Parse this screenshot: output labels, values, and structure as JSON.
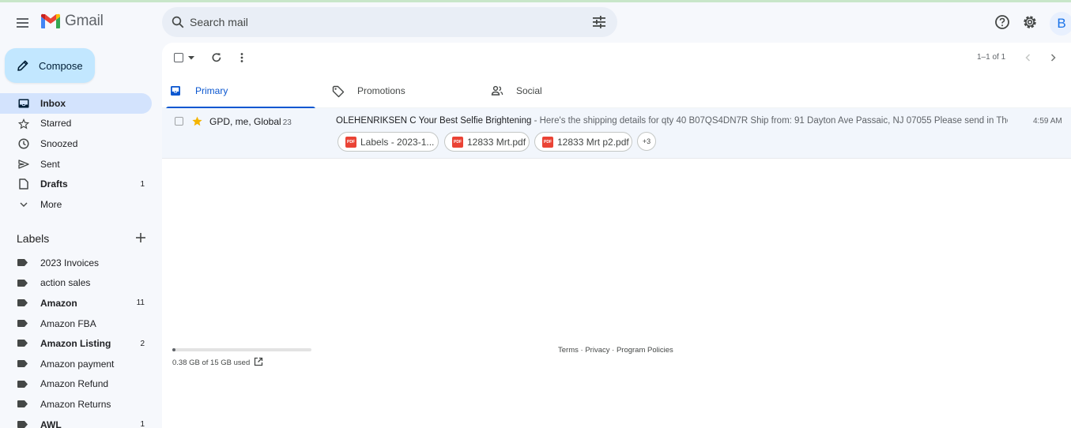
{
  "app": {
    "name": "Gmail",
    "avatar_initial": "B"
  },
  "search": {
    "placeholder": "Search mail"
  },
  "compose": {
    "label": "Compose"
  },
  "nav": [
    {
      "label": "Inbox",
      "icon": "inbox-icon",
      "count": "",
      "active": true,
      "bold": true
    },
    {
      "label": "Starred",
      "icon": "star-outline-icon",
      "count": ""
    },
    {
      "label": "Snoozed",
      "icon": "clock-icon",
      "count": ""
    },
    {
      "label": "Sent",
      "icon": "send-icon",
      "count": ""
    },
    {
      "label": "Drafts",
      "icon": "draft-icon",
      "count": "1",
      "bold": true
    },
    {
      "label": "More",
      "icon": "chevron-down-icon",
      "count": ""
    }
  ],
  "labels": {
    "heading": "Labels",
    "items": [
      {
        "label": "2023 Invoices",
        "count": ""
      },
      {
        "label": "action sales",
        "count": ""
      },
      {
        "label": "Amazon",
        "count": "11",
        "bold": true
      },
      {
        "label": "Amazon FBA",
        "count": ""
      },
      {
        "label": "Amazon Listing",
        "count": "2",
        "bold": true
      },
      {
        "label": "Amazon payment",
        "count": ""
      },
      {
        "label": "Amazon Refund",
        "count": ""
      },
      {
        "label": "Amazon Returns",
        "count": ""
      },
      {
        "label": "AWL",
        "count": "1",
        "bold": true
      }
    ]
  },
  "toolbar": {
    "pagination": "1–1 of 1"
  },
  "tabs": [
    {
      "label": "Primary",
      "icon": "inbox-tab-icon",
      "active": true
    },
    {
      "label": "Promotions",
      "icon": "tag-icon"
    },
    {
      "label": "Social",
      "icon": "people-icon"
    }
  ],
  "emails": [
    {
      "senders": "GPD, me, Global",
      "thread_count": "23",
      "subject": "OLEHENRIKSEN C Your Best Selfie Brightening",
      "snippet": " - Here's the shipping details for qty 40 B07QS4DN7R Ship from: 91 Dayton Ave Passaic, NJ 07055 Please send in The...",
      "time": "4:59 AM",
      "starred": true,
      "attachments": [
        {
          "name": "Labels - 2023-1...",
          "type": "PDF"
        },
        {
          "name": "12833 Mrt.pdf",
          "type": "PDF"
        },
        {
          "name": "12833 Mrt p2.pdf",
          "type": "PDF"
        }
      ],
      "more_attachments": "+3"
    }
  ],
  "storage": {
    "text": "0.38 GB of 15 GB used",
    "fraction": 0.025
  },
  "footer": {
    "terms": "Terms",
    "privacy": "Privacy",
    "program": "Program Policies",
    "sep": " · "
  },
  "colors": {
    "accent": "#0b57d0",
    "compose_bg": "#c2e7ff",
    "active_nav": "#d3e3fd",
    "star": "#f4b400",
    "pdf": "#ea4335"
  }
}
